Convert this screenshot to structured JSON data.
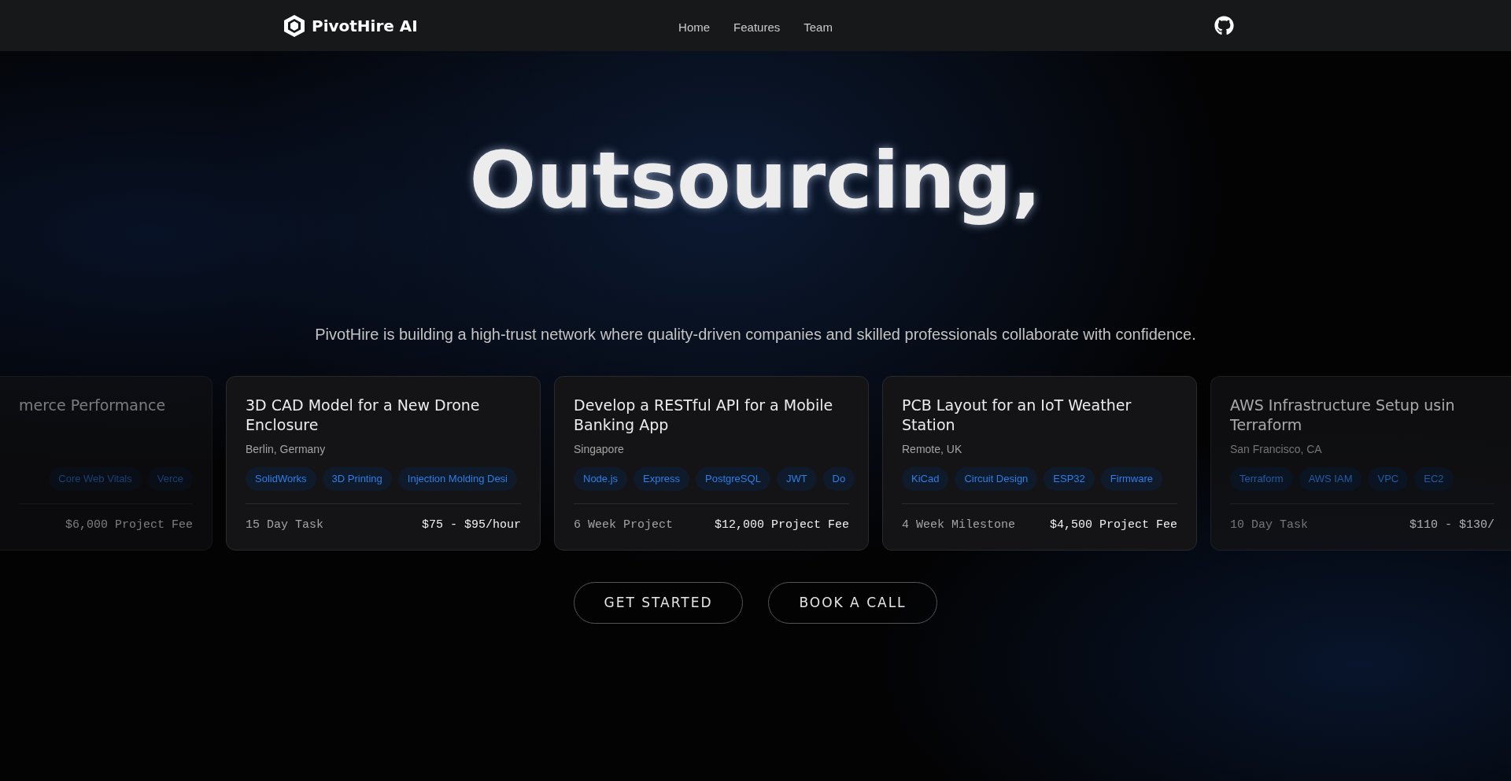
{
  "header": {
    "brand": "PivotHire AI",
    "nav": [
      {
        "label": "Home"
      },
      {
        "label": "Features"
      },
      {
        "label": "Team"
      }
    ]
  },
  "hero": {
    "title": "Outsourcing,",
    "subtitle": "PivotHire is building a high-trust network where quality-driven companies and skilled professionals collaborate with confidence."
  },
  "cards": [
    {
      "kind": "cut-left",
      "title": "merce Performance",
      "tags": [
        "Core Web Vitals",
        "Verce"
      ],
      "price": "$6,000 Project Fee"
    },
    {
      "kind": "full",
      "title": "3D CAD Model for a New Drone Enclosure",
      "location": "Berlin, Germany",
      "tags": [
        "SolidWorks",
        "3D Printing",
        "Injection Molding Desi"
      ],
      "duration": "15 Day Task",
      "price": "$75 - $95/hour"
    },
    {
      "kind": "full",
      "title": "Develop a RESTful API for a Mobile Banking App",
      "location": "Singapore",
      "tags": [
        "Node.js",
        "Express",
        "PostgreSQL",
        "JWT",
        "Do"
      ],
      "duration": "6 Week Project",
      "price": "$12,000 Project Fee"
    },
    {
      "kind": "full",
      "title": "PCB Layout for an IoT Weather Station",
      "location": "Remote, UK",
      "tags": [
        "KiCad",
        "Circuit Design",
        "ESP32",
        "Firmware"
      ],
      "duration": "4 Week Milestone",
      "price": "$4,500 Project Fee"
    },
    {
      "kind": "cut-right",
      "title": "AWS Infrastructure Setup usin Terraform",
      "location": "San Francisco, CA",
      "tags": [
        "Terraform",
        "AWS IAM",
        "VPC",
        "EC2"
      ],
      "duration": "10 Day Task",
      "price": "$110 - $130/"
    }
  ],
  "buttons": [
    {
      "label": "GET STARTED"
    },
    {
      "label": "BOOK A CALL"
    }
  ]
}
